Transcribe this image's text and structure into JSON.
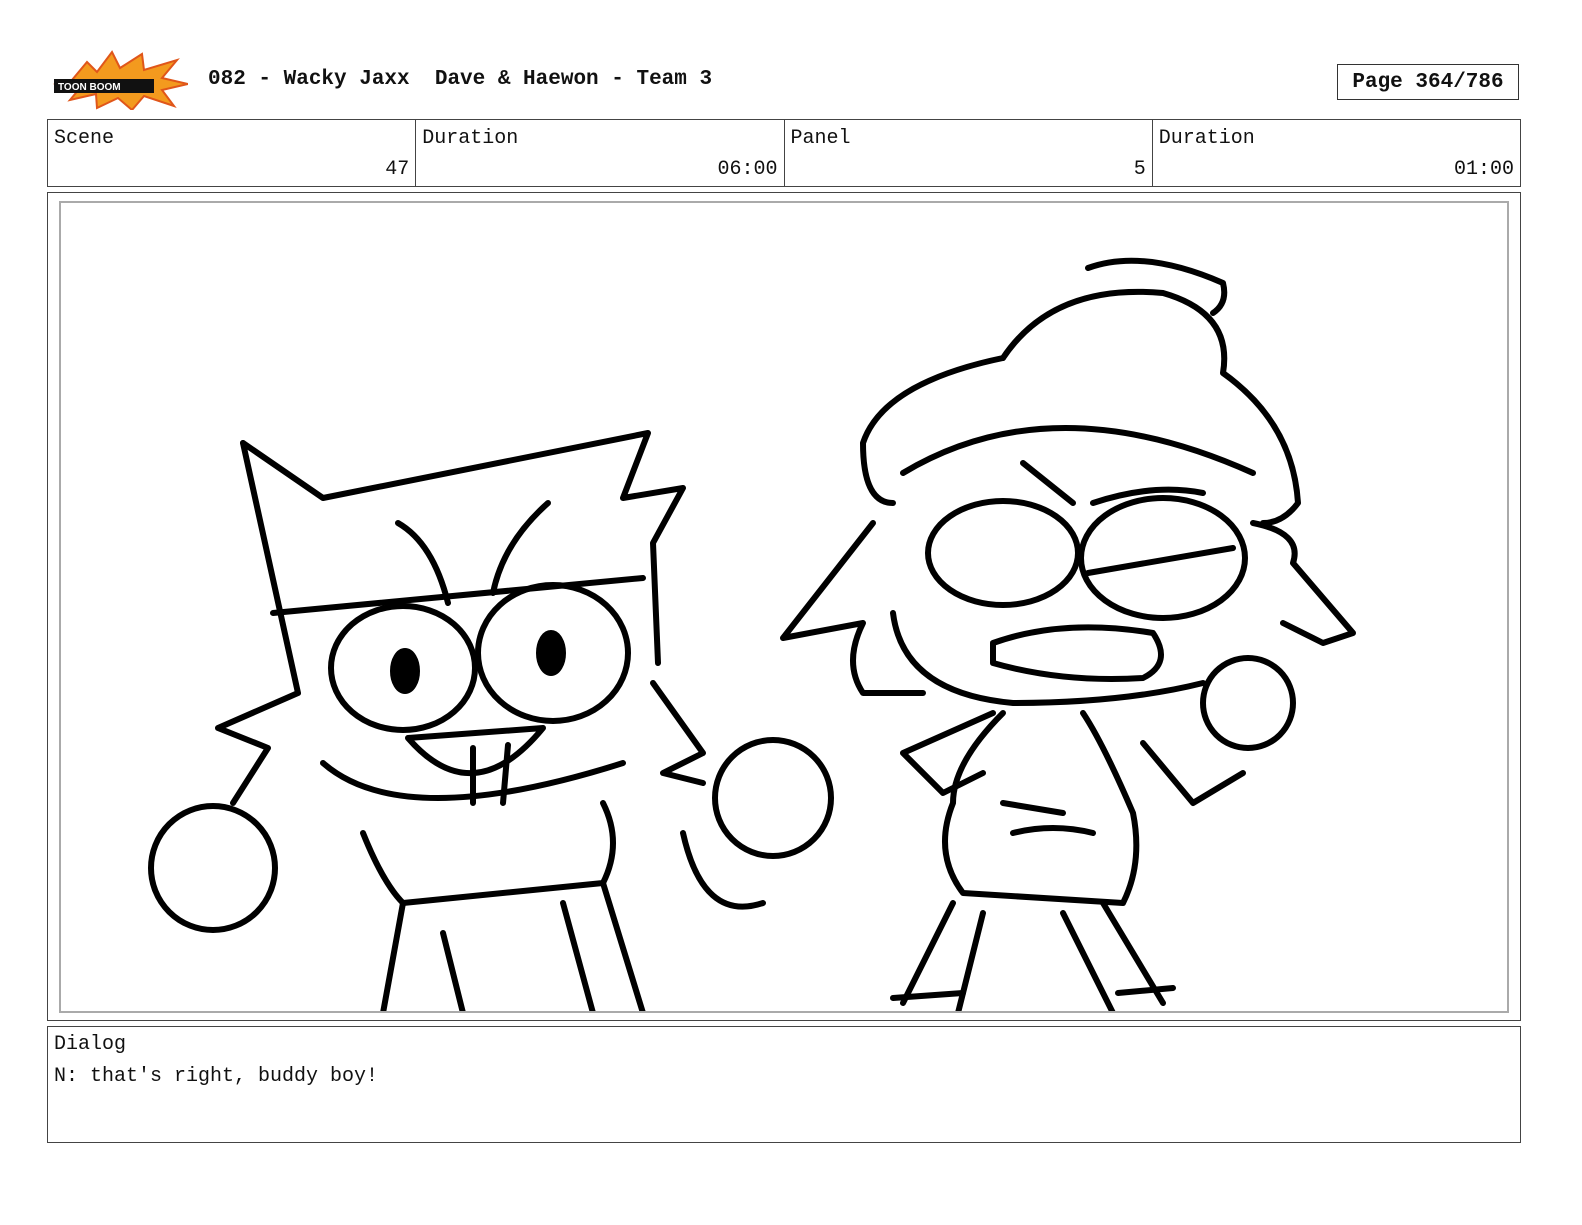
{
  "header": {
    "logo_text": "TOON BOOM",
    "title": "082 - Wacky Jaxx  Dave & Haewon - Team 3",
    "page": "Page 364/786"
  },
  "info": [
    {
      "label": "Scene",
      "value": "47"
    },
    {
      "label": "Duration",
      "value": "06:00"
    },
    {
      "label": "Panel",
      "value": "5"
    },
    {
      "label": "Duration",
      "value": "01:00"
    }
  ],
  "dialog": {
    "label": "Dialog",
    "text": "N: that's right, buddy boy!"
  }
}
